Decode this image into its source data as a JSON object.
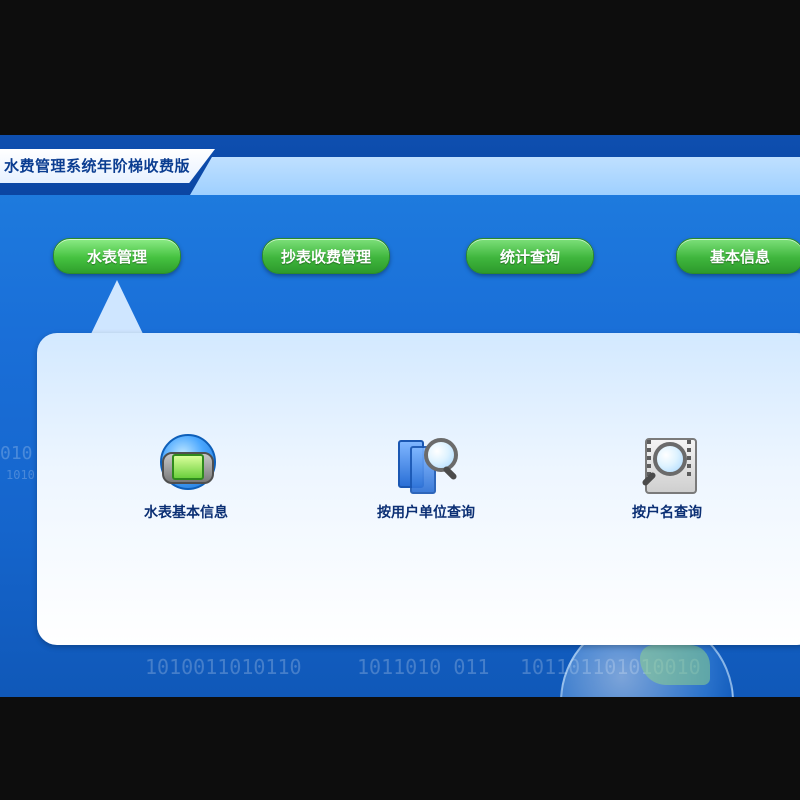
{
  "app": {
    "title": "水费管理系统年阶梯收费版"
  },
  "nav": {
    "items": [
      {
        "label": "水表管理",
        "active": true
      },
      {
        "label": "抄表收费管理",
        "active": false
      },
      {
        "label": "统计查询",
        "active": false
      },
      {
        "label": "基本信息",
        "active": false
      }
    ]
  },
  "functions": [
    {
      "label": "水表基本信息",
      "icon": "water-meter-info-icon"
    },
    {
      "label": "按用户单位查询",
      "icon": "query-by-unit-icon"
    },
    {
      "label": "按户名查询",
      "icon": "query-by-name-icon"
    }
  ],
  "decor": {
    "binary_1": "1010011010110",
    "binary_2": "1011010  011",
    "binary_3": "101101101010010",
    "binary_4": "010",
    "binary_5": "1010"
  }
}
